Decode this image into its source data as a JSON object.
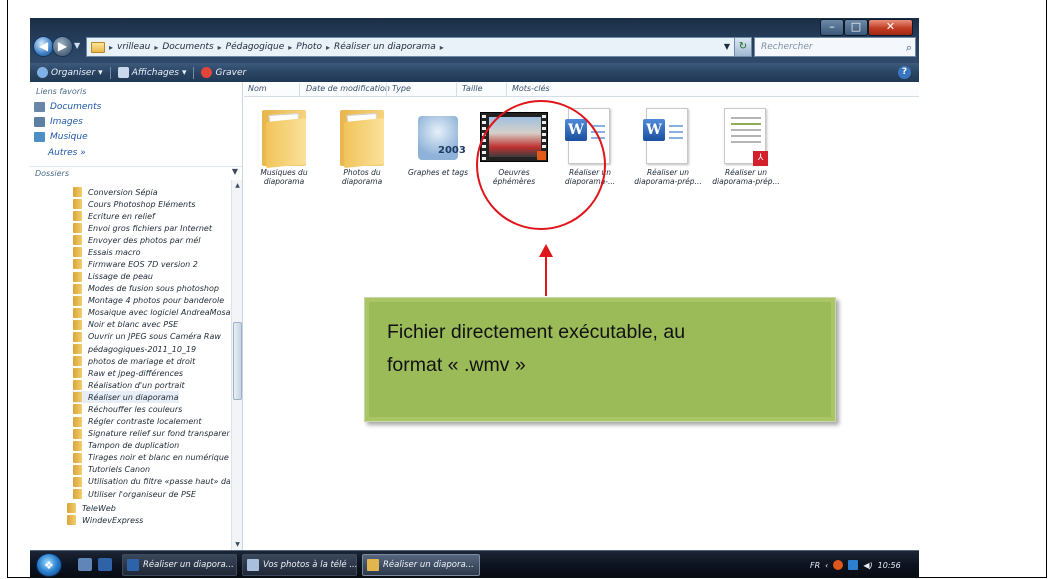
{
  "window": {
    "breadcrumb": [
      "vrilleau",
      "Documents",
      "Pédagogique",
      "Photo",
      "Réaliser un diaporama"
    ],
    "search_placeholder": "Rechercher",
    "controls": {
      "minimize": "–",
      "maximize": "□",
      "close": "✕"
    }
  },
  "toolbar": {
    "organize": "Organiser",
    "views": "Affichages",
    "burn": "Graver"
  },
  "nav_pane": {
    "favorites_title": "Liens favoris",
    "favorites": [
      "Documents",
      "Images",
      "Musique"
    ],
    "more": "Autres »",
    "folders_title": "Dossiers",
    "tree": [
      "Conversion Sépia",
      "Cours Photoshop Eléments",
      "Ecriture en relief",
      "Envoi gros fichiers par Internet",
      "Envoyer des photos par mél",
      "Essais macro",
      "Firmware EOS 7D version 2",
      "Lissage de peau",
      "Modes de fusion sous photoshop",
      "Montage 4 photos pour banderole",
      "Mosaique avec logiciel AndreaMosaic",
      "Noir et blanc avec PSE",
      "Ouvrir un JPEG sous Caméra Raw",
      "pédagogiques-2011_10_19",
      "photos de mariage et droit",
      "Raw et jpeg-différences",
      "Réalisation d'un portrait",
      "Réaliser un diaporama",
      "Réchouffer les couleurs",
      "Régler contraste localement",
      "Signature relief sur fond transparent",
      "Tampon de duplication",
      "Tirages noir et blanc en numérique",
      "Tutoriels Canon",
      "Utilisation du filtre «passe haut» dans",
      "Utiliser l'organiseur de PSE"
    ],
    "tree_root": [
      "TeleWeb",
      "WindevExpress"
    ],
    "selected": "Réaliser un diaporama"
  },
  "content": {
    "columns": [
      "Nom",
      "Date de modification",
      "Type",
      "Taille",
      "Mots-clés"
    ],
    "files": [
      {
        "label": "Musiques du diaporama",
        "kind": "folder"
      },
      {
        "label": "Photos du diaporama",
        "kind": "folder"
      },
      {
        "label": "Graphes et tags",
        "kind": "graph",
        "badge": "2003"
      },
      {
        "label": "Oeuvres éphémères",
        "kind": "video"
      },
      {
        "label": "Réaliser un diaporama-...",
        "kind": "word"
      },
      {
        "label": "Réaliser un diaporama-prép...",
        "kind": "word"
      },
      {
        "label": "Réaliser un diaporama-prép...",
        "kind": "pdf"
      }
    ]
  },
  "annotation": {
    "text_line1": "Fichier directement exécutable, au",
    "text_line2": "format « .wmv »",
    "callout_color": "#9bbb59",
    "circle_color": "#e0141b"
  },
  "taskbar": {
    "tasks": [
      "Réaliser un diapora...",
      "Vos photos à la télé ...",
      "Réaliser un diapora..."
    ],
    "language": "FR",
    "clock": "10:56"
  }
}
